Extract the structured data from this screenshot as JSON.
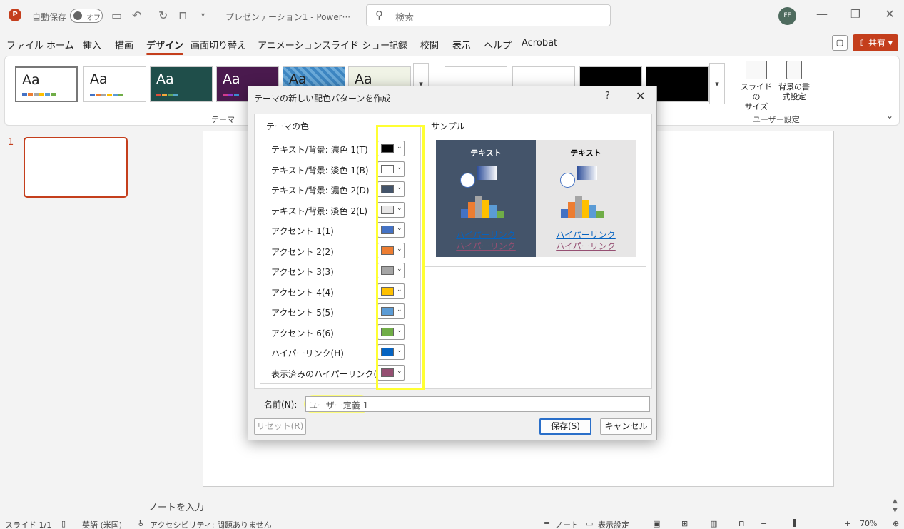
{
  "titlebar": {
    "app_logo": "P",
    "autosave_label": "自動保存",
    "autosave_state": "オフ",
    "doc_title": "プレゼンテーション1 - Power···",
    "search_placeholder": "検索",
    "user_initials": "FF"
  },
  "menu": {
    "tabs": [
      "ファイル",
      "ホーム",
      "挿入",
      "描画",
      "デザイン",
      "画面切り替え",
      "アニメーション",
      "スライド ショー",
      "記録",
      "校閲",
      "表示",
      "ヘルプ",
      "Acrobat"
    ],
    "active": "デザイン",
    "share_label": "共有"
  },
  "ribbon": {
    "theme_sample": "Aa",
    "themes_group_label": "テーマ",
    "slide_size_label": "スライドの\nサイズ",
    "bg_format_label": "背景の書\n式設定",
    "user_settings_group": "ユーザー設定"
  },
  "thumbnails": {
    "slide_number": "1"
  },
  "notes": {
    "placeholder": "ノートを入力"
  },
  "status": {
    "slide_count": "スライド 1/1",
    "language": "英語 (米国)",
    "accessibility": "アクセシビリティ: 問題ありません",
    "notes_btn": "ノート",
    "display_settings": "表示設定",
    "zoom": "70%"
  },
  "dialog": {
    "title": "テーマの新しい配色パターンを作成",
    "help": "?",
    "close": "✕",
    "theme_colors_group": "テーマの色",
    "sample_group": "サンプル",
    "colors": [
      {
        "label": "テキスト/背景: 濃色 1(T)",
        "color": "#000000"
      },
      {
        "label": "テキスト/背景: 淡色 1(B)",
        "color": "#ffffff"
      },
      {
        "label": "テキスト/背景: 濃色 2(D)",
        "color": "#44546a"
      },
      {
        "label": "テキスト/背景: 淡色 2(L)",
        "color": "#e7e6e6"
      },
      {
        "label": "アクセント 1(1)",
        "color": "#4472c4"
      },
      {
        "label": "アクセント 2(2)",
        "color": "#ed7d31"
      },
      {
        "label": "アクセント 3(3)",
        "color": "#a5a5a5"
      },
      {
        "label": "アクセント 4(4)",
        "color": "#ffc000"
      },
      {
        "label": "アクセント 5(5)",
        "color": "#5b9bd5"
      },
      {
        "label": "アクセント 6(6)",
        "color": "#70ad47"
      },
      {
        "label": "ハイパーリンク(H)",
        "color": "#0563c1"
      },
      {
        "label": "表示済みのハイパーリンク(F)",
        "color": "#954f72"
      }
    ],
    "sample_text": "テキスト",
    "sample_link": "ハイパーリンク",
    "sample_visited_link": "ハイパーリンク",
    "name_label": "名前(N):",
    "name_value": "ユーザー定義 1",
    "reset_label": "リセット(R)",
    "save_label": "保存(S)",
    "cancel_label": "キャンセル"
  }
}
